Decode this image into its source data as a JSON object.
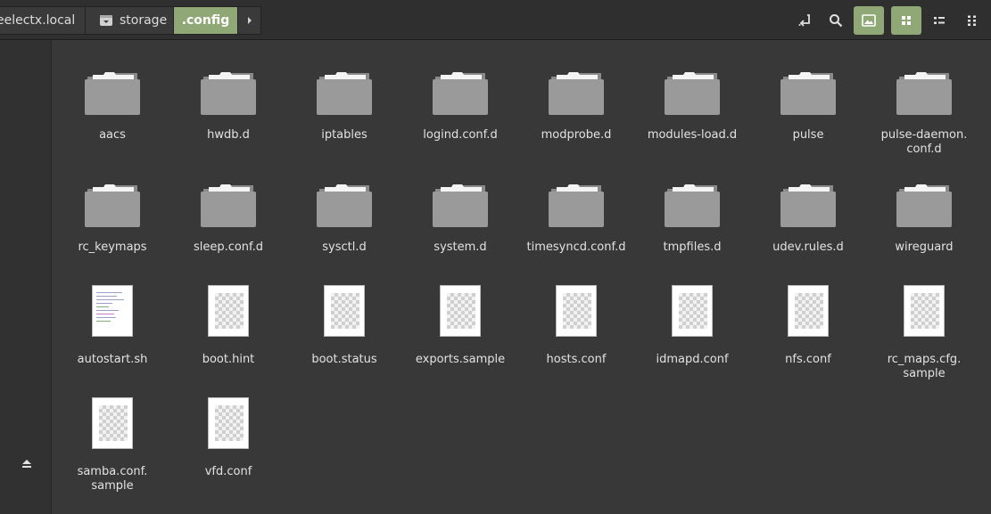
{
  "breadcrumb": {
    "host": "eelectx.local",
    "storage": "storage",
    "current": ".config"
  },
  "toolbar": {
    "buttons": [
      "toggle-location-icon",
      "search-icon",
      "thumbnail-view-icon",
      "icon-view-icon",
      "compact-view-icon",
      "list-view-icon"
    ]
  },
  "items": [
    {
      "name": "aacs",
      "type": "folder"
    },
    {
      "name": "hwdb.d",
      "type": "folder"
    },
    {
      "name": "iptables",
      "type": "folder"
    },
    {
      "name": "logind.conf.d",
      "type": "folder"
    },
    {
      "name": "modprobe.d",
      "type": "folder"
    },
    {
      "name": "modules-load.d",
      "type": "folder"
    },
    {
      "name": "pulse",
      "type": "folder"
    },
    {
      "name": "pulse-daemon.\nconf.d",
      "type": "folder"
    },
    {
      "name": "rc_keymaps",
      "type": "folder"
    },
    {
      "name": "sleep.conf.d",
      "type": "folder"
    },
    {
      "name": "sysctl.d",
      "type": "folder"
    },
    {
      "name": "system.d",
      "type": "folder"
    },
    {
      "name": "timesyncd.conf.d",
      "type": "folder"
    },
    {
      "name": "tmpfiles.d",
      "type": "folder"
    },
    {
      "name": "udev.rules.d",
      "type": "folder"
    },
    {
      "name": "wireguard",
      "type": "folder"
    },
    {
      "name": "autostart.sh",
      "type": "script"
    },
    {
      "name": "boot.hint",
      "type": "file"
    },
    {
      "name": "boot.status",
      "type": "file"
    },
    {
      "name": "exports.sample",
      "type": "file"
    },
    {
      "name": "hosts.conf",
      "type": "file"
    },
    {
      "name": "idmapd.conf",
      "type": "file"
    },
    {
      "name": "nfs.conf",
      "type": "file"
    },
    {
      "name": "rc_maps.cfg.\nsample",
      "type": "file"
    },
    {
      "name": "samba.conf.\nsample",
      "type": "file"
    },
    {
      "name": "vfd.conf",
      "type": "file"
    }
  ]
}
